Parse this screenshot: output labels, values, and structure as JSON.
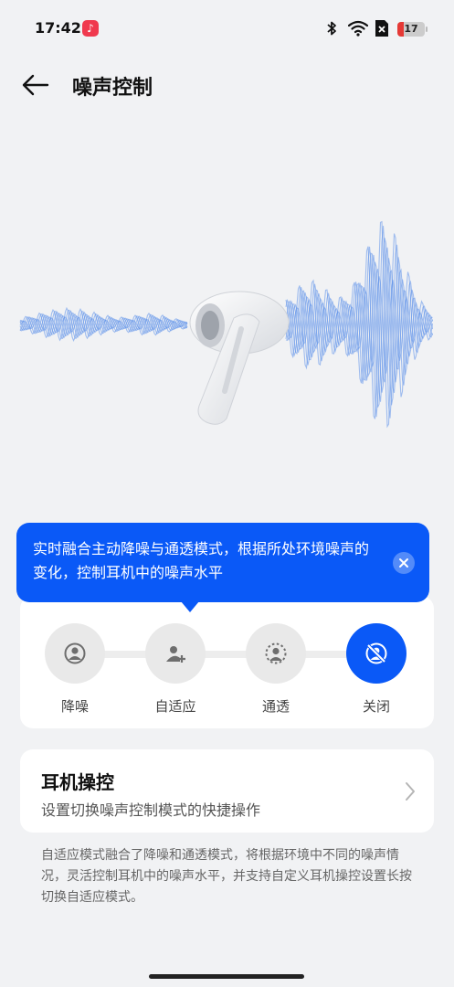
{
  "status_bar": {
    "time": "17:42",
    "music_app_icon": "music-icon",
    "icons": [
      "bluetooth-icon",
      "wifi-icon",
      "no-sim-icon"
    ],
    "battery_level": "17",
    "battery_color": "#e53935"
  },
  "header": {
    "back_icon": "back-arrow-icon",
    "title": "噪声控制"
  },
  "tooltip": {
    "text": "实时融合主动降噪与通透模式，根据所处环境噪声的变化，控制耳机中的噪声水平",
    "close_icon": "close-icon"
  },
  "modes": {
    "items": [
      {
        "label": "降噪",
        "icon": "noise-cancel-icon",
        "selected": false
      },
      {
        "label": "自适应",
        "icon": "adaptive-icon",
        "selected": false
      },
      {
        "label": "通透",
        "icon": "transparency-icon",
        "selected": false
      },
      {
        "label": "关闭",
        "icon": "noise-off-icon",
        "selected": true
      }
    ]
  },
  "earbud_control": {
    "title": "耳机操控",
    "subtitle": "设置切换噪声控制模式的快捷操作",
    "chevron_icon": "chevron-right-icon"
  },
  "footnote": "自适应模式融合了降噪和通透模式，将根据环境中不同的噪声情况，灵活控制耳机中的噪声水平，并支持自定义耳机操控设置长按切换自适应模式。",
  "colors": {
    "accent": "#0a59f7",
    "background": "#F1F2F4",
    "wave": "#5b8fea"
  }
}
